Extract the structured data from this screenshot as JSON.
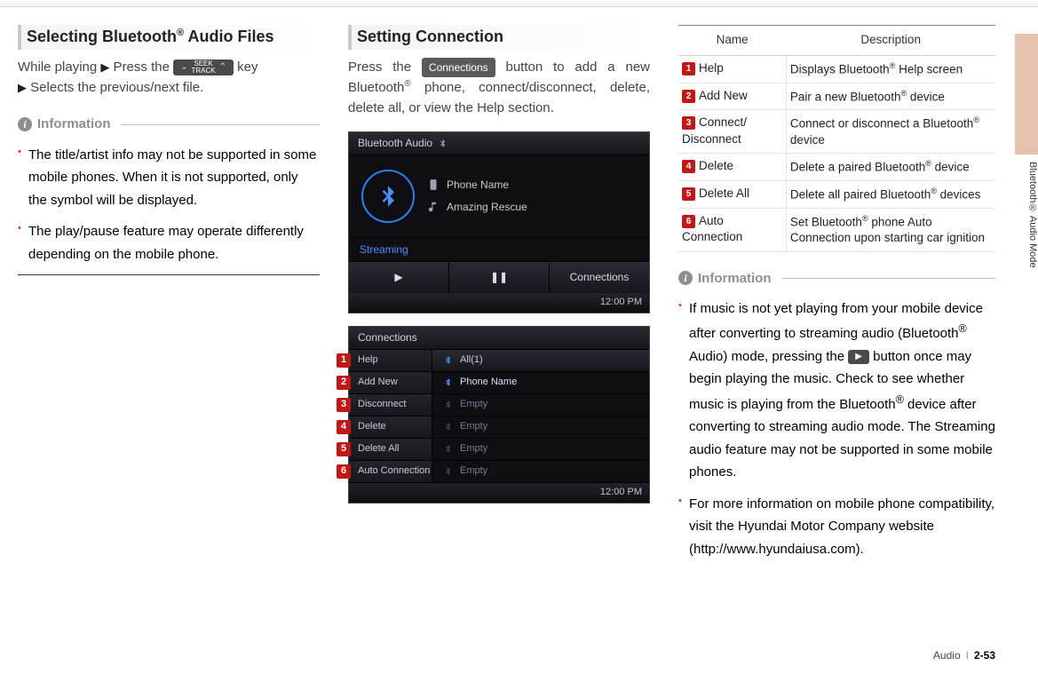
{
  "col1": {
    "heading_pre": "Selecting Bluetooth",
    "heading_post": " Audio Files",
    "line1_a": "While playing ",
    "line1_b": " Press the ",
    "line1_c": " key",
    "seek_top": "SEEK",
    "seek_bottom": "TRACK",
    "line2": " Selects the previous/next file.",
    "info_label": "Information",
    "note1": "The title/artist info may not be supported in some mobile phones. When it is not supported, only the symbol will be displayed.",
    "note2": "The play/pause feature may operate differently depending on the mobile phone."
  },
  "col2": {
    "heading": "Setting Connection",
    "para_a": "Press the ",
    "conn_btn": "Connections",
    "para_b": " button to add a new Bluetooth",
    "para_c": " phone, connect/disconnect, delete, delete all, or view the Help section.",
    "shot1": {
      "bar": "Bluetooth Audio",
      "phone": "Phone Name",
      "track": "Amazing Rescue",
      "streaming": "Streaming",
      "ctrl_play": "▶",
      "ctrl_pause": "❚❚",
      "ctrl_conn": "Connections",
      "clock": "12:00 PM"
    },
    "shot2": {
      "bar": "Connections",
      "sidebar": [
        "Help",
        "Add New",
        "Disconnect",
        "Delete",
        "Delete All",
        "Auto Connection"
      ],
      "list_header": "All(1)",
      "list_rows": [
        "Phone Name",
        "Empty",
        "Empty",
        "Empty",
        "Empty"
      ],
      "clock": "12:00 PM",
      "badges": [
        "1",
        "2",
        "3",
        "4",
        "5",
        "6"
      ]
    }
  },
  "col3": {
    "table": {
      "head_name": "Name",
      "head_desc": "Description",
      "rows": [
        {
          "n": "1",
          "name": "Help",
          "desc_a": "Displays Bluetooth",
          "desc_b": " Help screen"
        },
        {
          "n": "2",
          "name": "Add New",
          "desc_a": "Pair a new Bluetooth",
          "desc_b": " device"
        },
        {
          "n": "3",
          "name": "Connect/\nDisconnect",
          "desc_a": "Connect or disconnect a Bluetooth",
          "desc_b": " device"
        },
        {
          "n": "4",
          "name": "Delete",
          "desc_a": "Delete a paired Bluetooth",
          "desc_b": " device"
        },
        {
          "n": "5",
          "name": "Delete All",
          "desc_a": "Delete all paired Bluetooth",
          "desc_b": " devices"
        },
        {
          "n": "6",
          "name": "Auto\nConnection",
          "desc_a": "Set Bluetooth",
          "desc_b": " phone Auto Connection upon starting car ignition"
        }
      ]
    },
    "info_label": "Information",
    "note1_a": "If music is not yet playing from your mobile device after converting to streaming audio (Bluetooth",
    "note1_b": " Audio) mode, pressing the ",
    "note1_c": " button once may begin playing the music. Check to see whether music is playing from the Bluetooth",
    "note1_d": " device after converting to streaming audio mode. The Streaming audio feature may not be supported in some mobile phones.",
    "note2": "For more information on mobile phone compatibility, visit the Hyundai Motor Company website (http://www.hyundaiusa.com)."
  },
  "sidetab": "Bluetooth® Audio Mode",
  "footer": {
    "section": "Audio",
    "page": "2-53"
  },
  "reg": "®"
}
